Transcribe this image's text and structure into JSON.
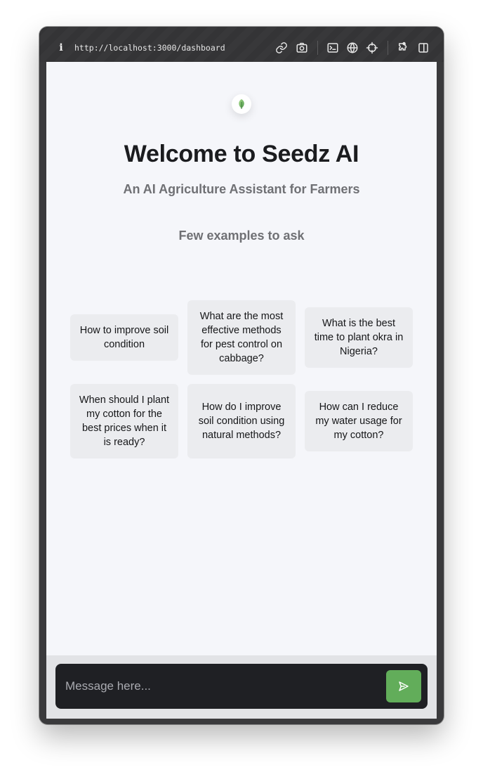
{
  "browser": {
    "url": "http://localhost:3000/dashboard",
    "info_icon": "i",
    "icons": [
      "link-icon",
      "camera-icon",
      "terminal-icon",
      "globe-icon",
      "crosshair-icon",
      "extensions-icon",
      "sidebar-icon"
    ]
  },
  "app": {
    "logo_icon": "leaf-icon",
    "title": "Welcome to Seedz AI",
    "subtitle": "An AI Agriculture Assistant for Farmers",
    "examples_heading": "Few examples to ask",
    "examples": [
      "How to improve soil condition",
      "What are the most effective methods for pest control on cabbage?",
      "What is the best time to plant okra in Nigeria?",
      "When should I plant my cotton for the best prices when it is ready?",
      "How do I improve soil condition using natural methods?",
      "How can I reduce my water usage for my cotton?"
    ]
  },
  "composer": {
    "placeholder": "Message here...",
    "value": "",
    "send_icon": "send-icon"
  },
  "colors": {
    "accent": "#62ad5a",
    "page_background": "#f5f6fa",
    "card_background": "#ebecef",
    "composer_background": "#1f2024"
  }
}
